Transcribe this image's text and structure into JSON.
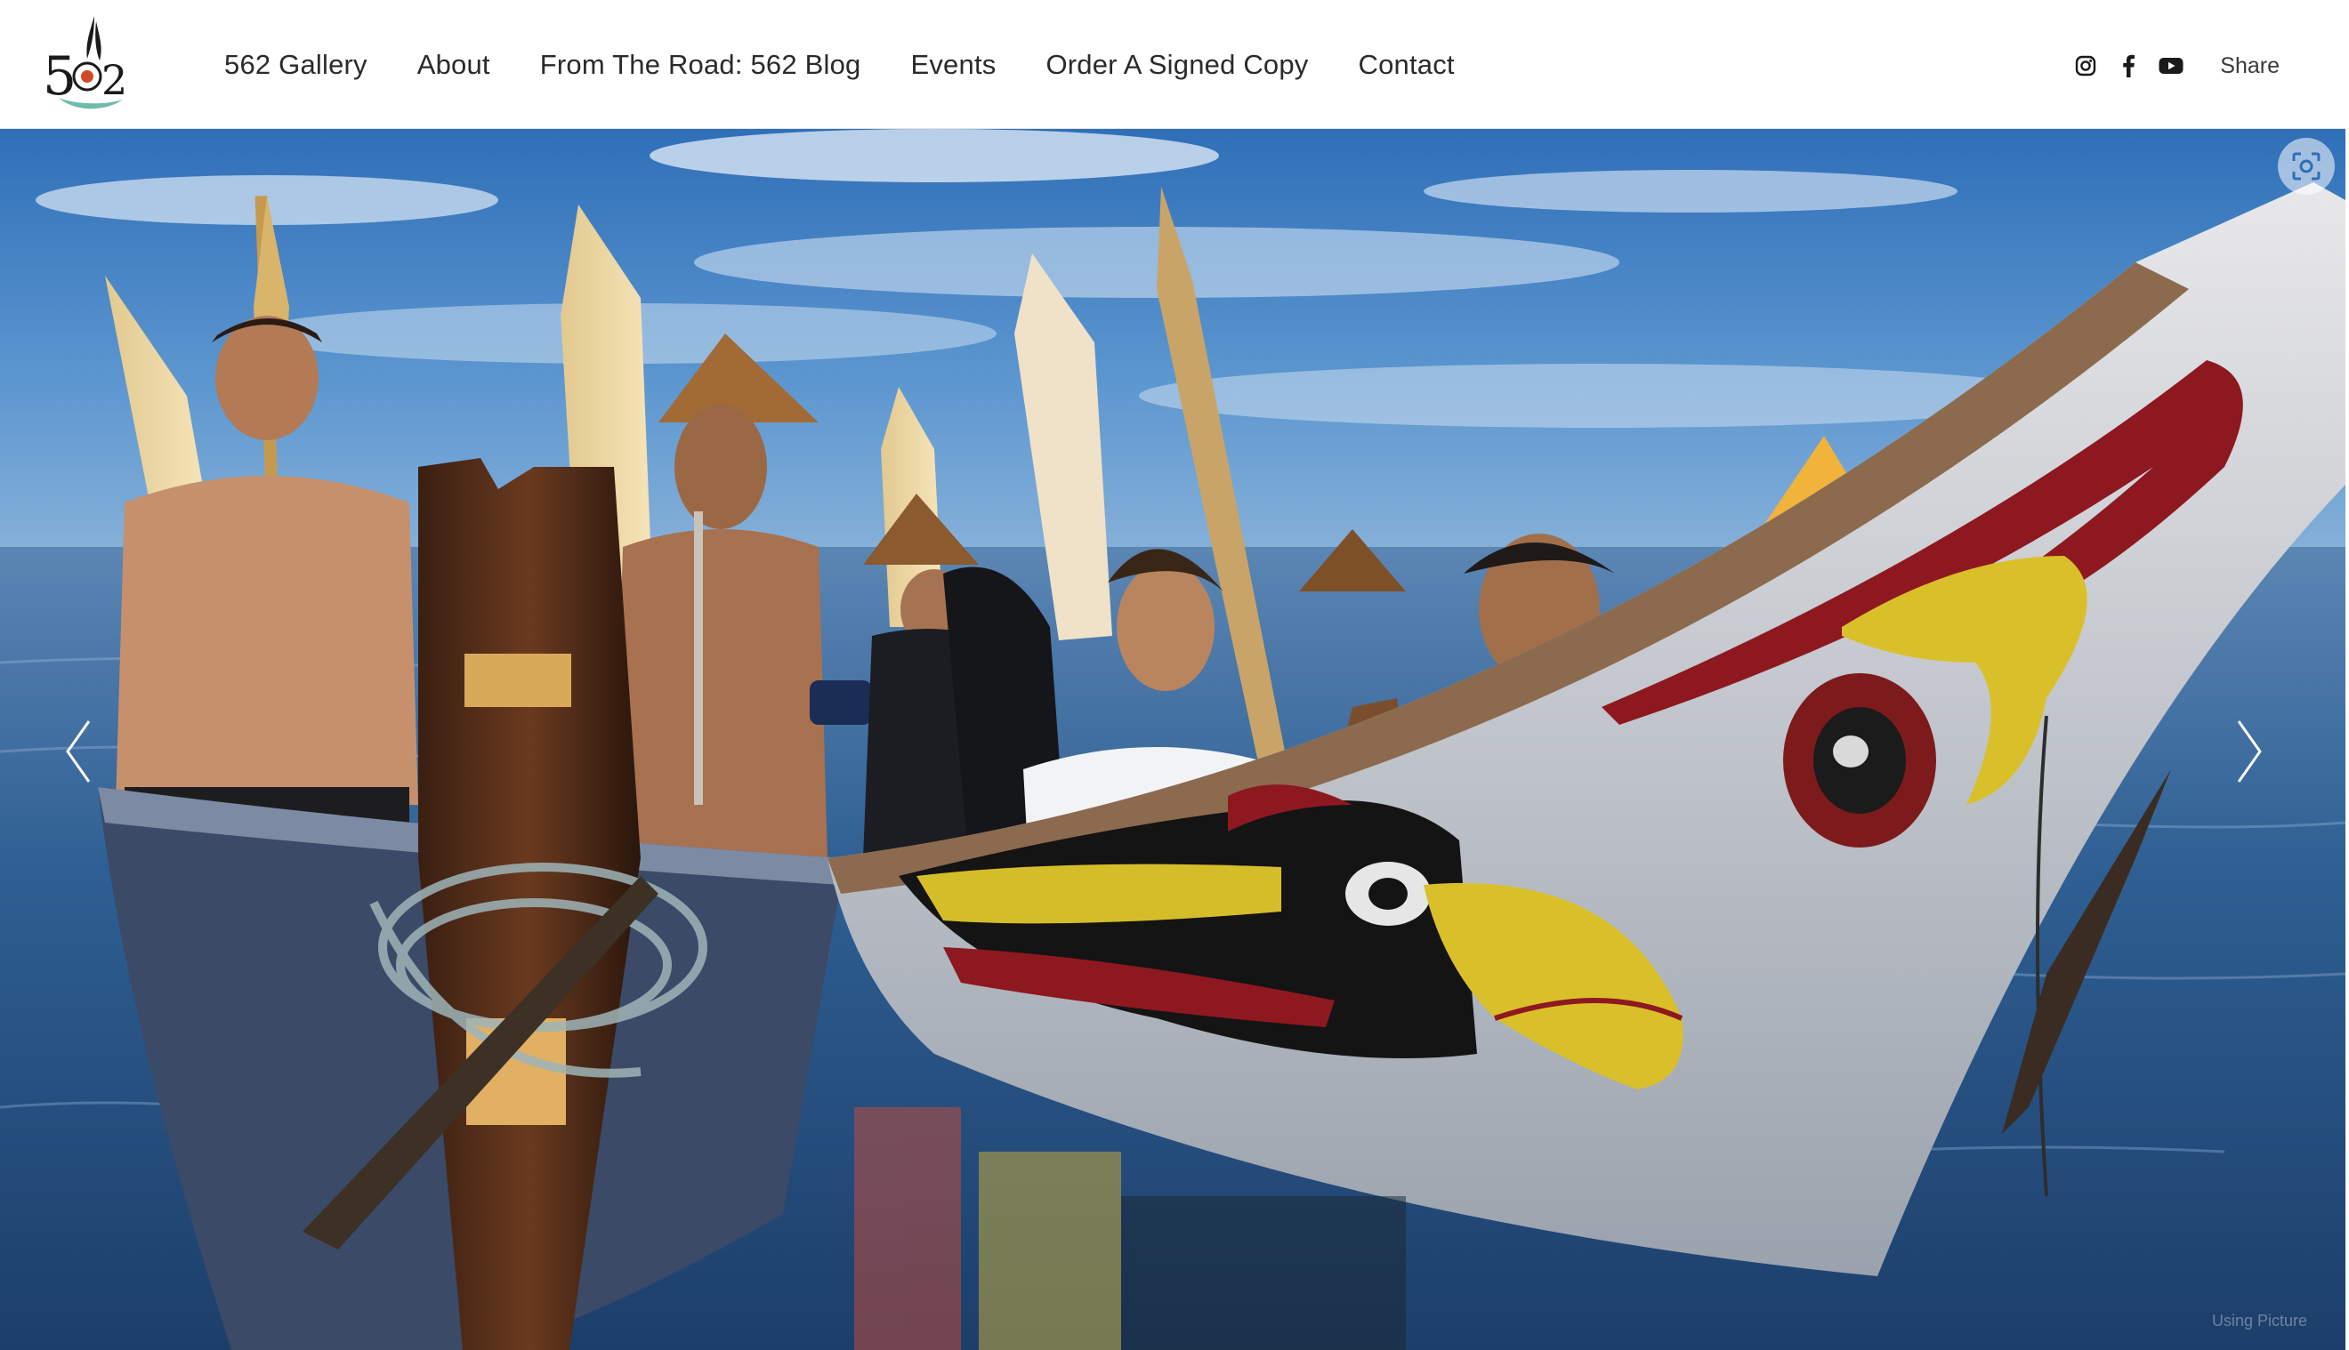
{
  "site": {
    "logo_icon": "562-logo-icon"
  },
  "nav": {
    "items": [
      {
        "label": "562 Gallery"
      },
      {
        "label": "About"
      },
      {
        "label": "From The Road: 562 Blog"
      },
      {
        "label": "Events"
      },
      {
        "label": "Order A Signed Copy"
      },
      {
        "label": "Contact"
      }
    ]
  },
  "social": {
    "icons": [
      "instagram-icon",
      "facebook-icon",
      "youtube-icon"
    ],
    "share_label": "Share"
  },
  "hero": {
    "image_subject": "canoe-photo",
    "prev_icon": "chevron-left-icon",
    "next_icon": "chevron-right-icon",
    "lens_icon": "visual-search-icon",
    "watermark": "Using Picture"
  },
  "colors": {
    "header_bg": "#ffffff",
    "nav_text": "#2a2a2a",
    "logo_red": "#d2492a",
    "logo_teal": "#6fbcae"
  }
}
